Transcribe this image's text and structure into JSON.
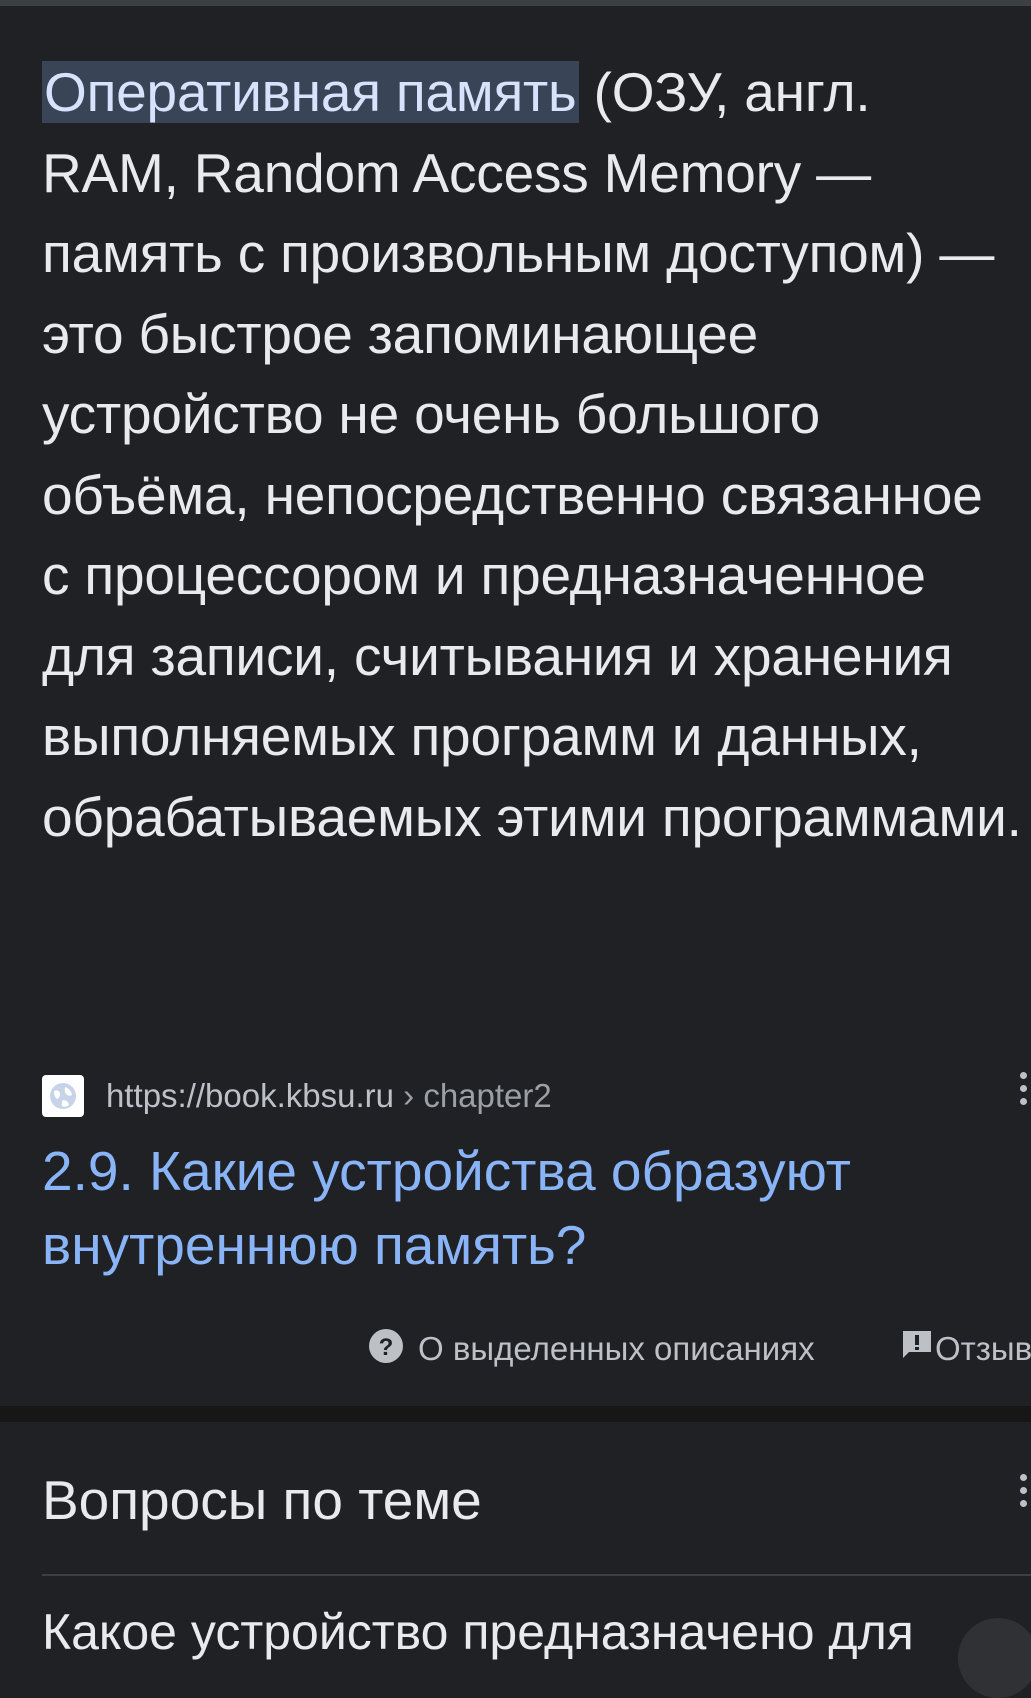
{
  "snippet": {
    "highlight": "Оперативная память",
    "text": " (ОЗУ, англ. RAM, Random Access Memory — память с произвольным доступом) — это быстрое запоминающее устройство не очень большого объёма, непосредственно связанное с процессором и предназначенное для записи, считывания и хранения выполняемых программ и данных, обрабатываемых этими программами."
  },
  "source": {
    "favicon": "globe-icon",
    "url": "https://book.kbsu.ru",
    "breadcrumb": " › chapter2"
  },
  "result": {
    "title": "2.9. Какие устройства образуют внутреннюю память?"
  },
  "footer": {
    "about_label": "О выделенных описаниях",
    "feedback_label": "Отзыв"
  },
  "questions": {
    "title": "Вопросы по теме",
    "first_item": "Какое устройство предназначено для"
  },
  "colors": {
    "background": "#202124",
    "text": "#e8eaed",
    "link": "#8ab4f8",
    "highlight_bg": "#394457",
    "muted": "#bdc1c6"
  }
}
